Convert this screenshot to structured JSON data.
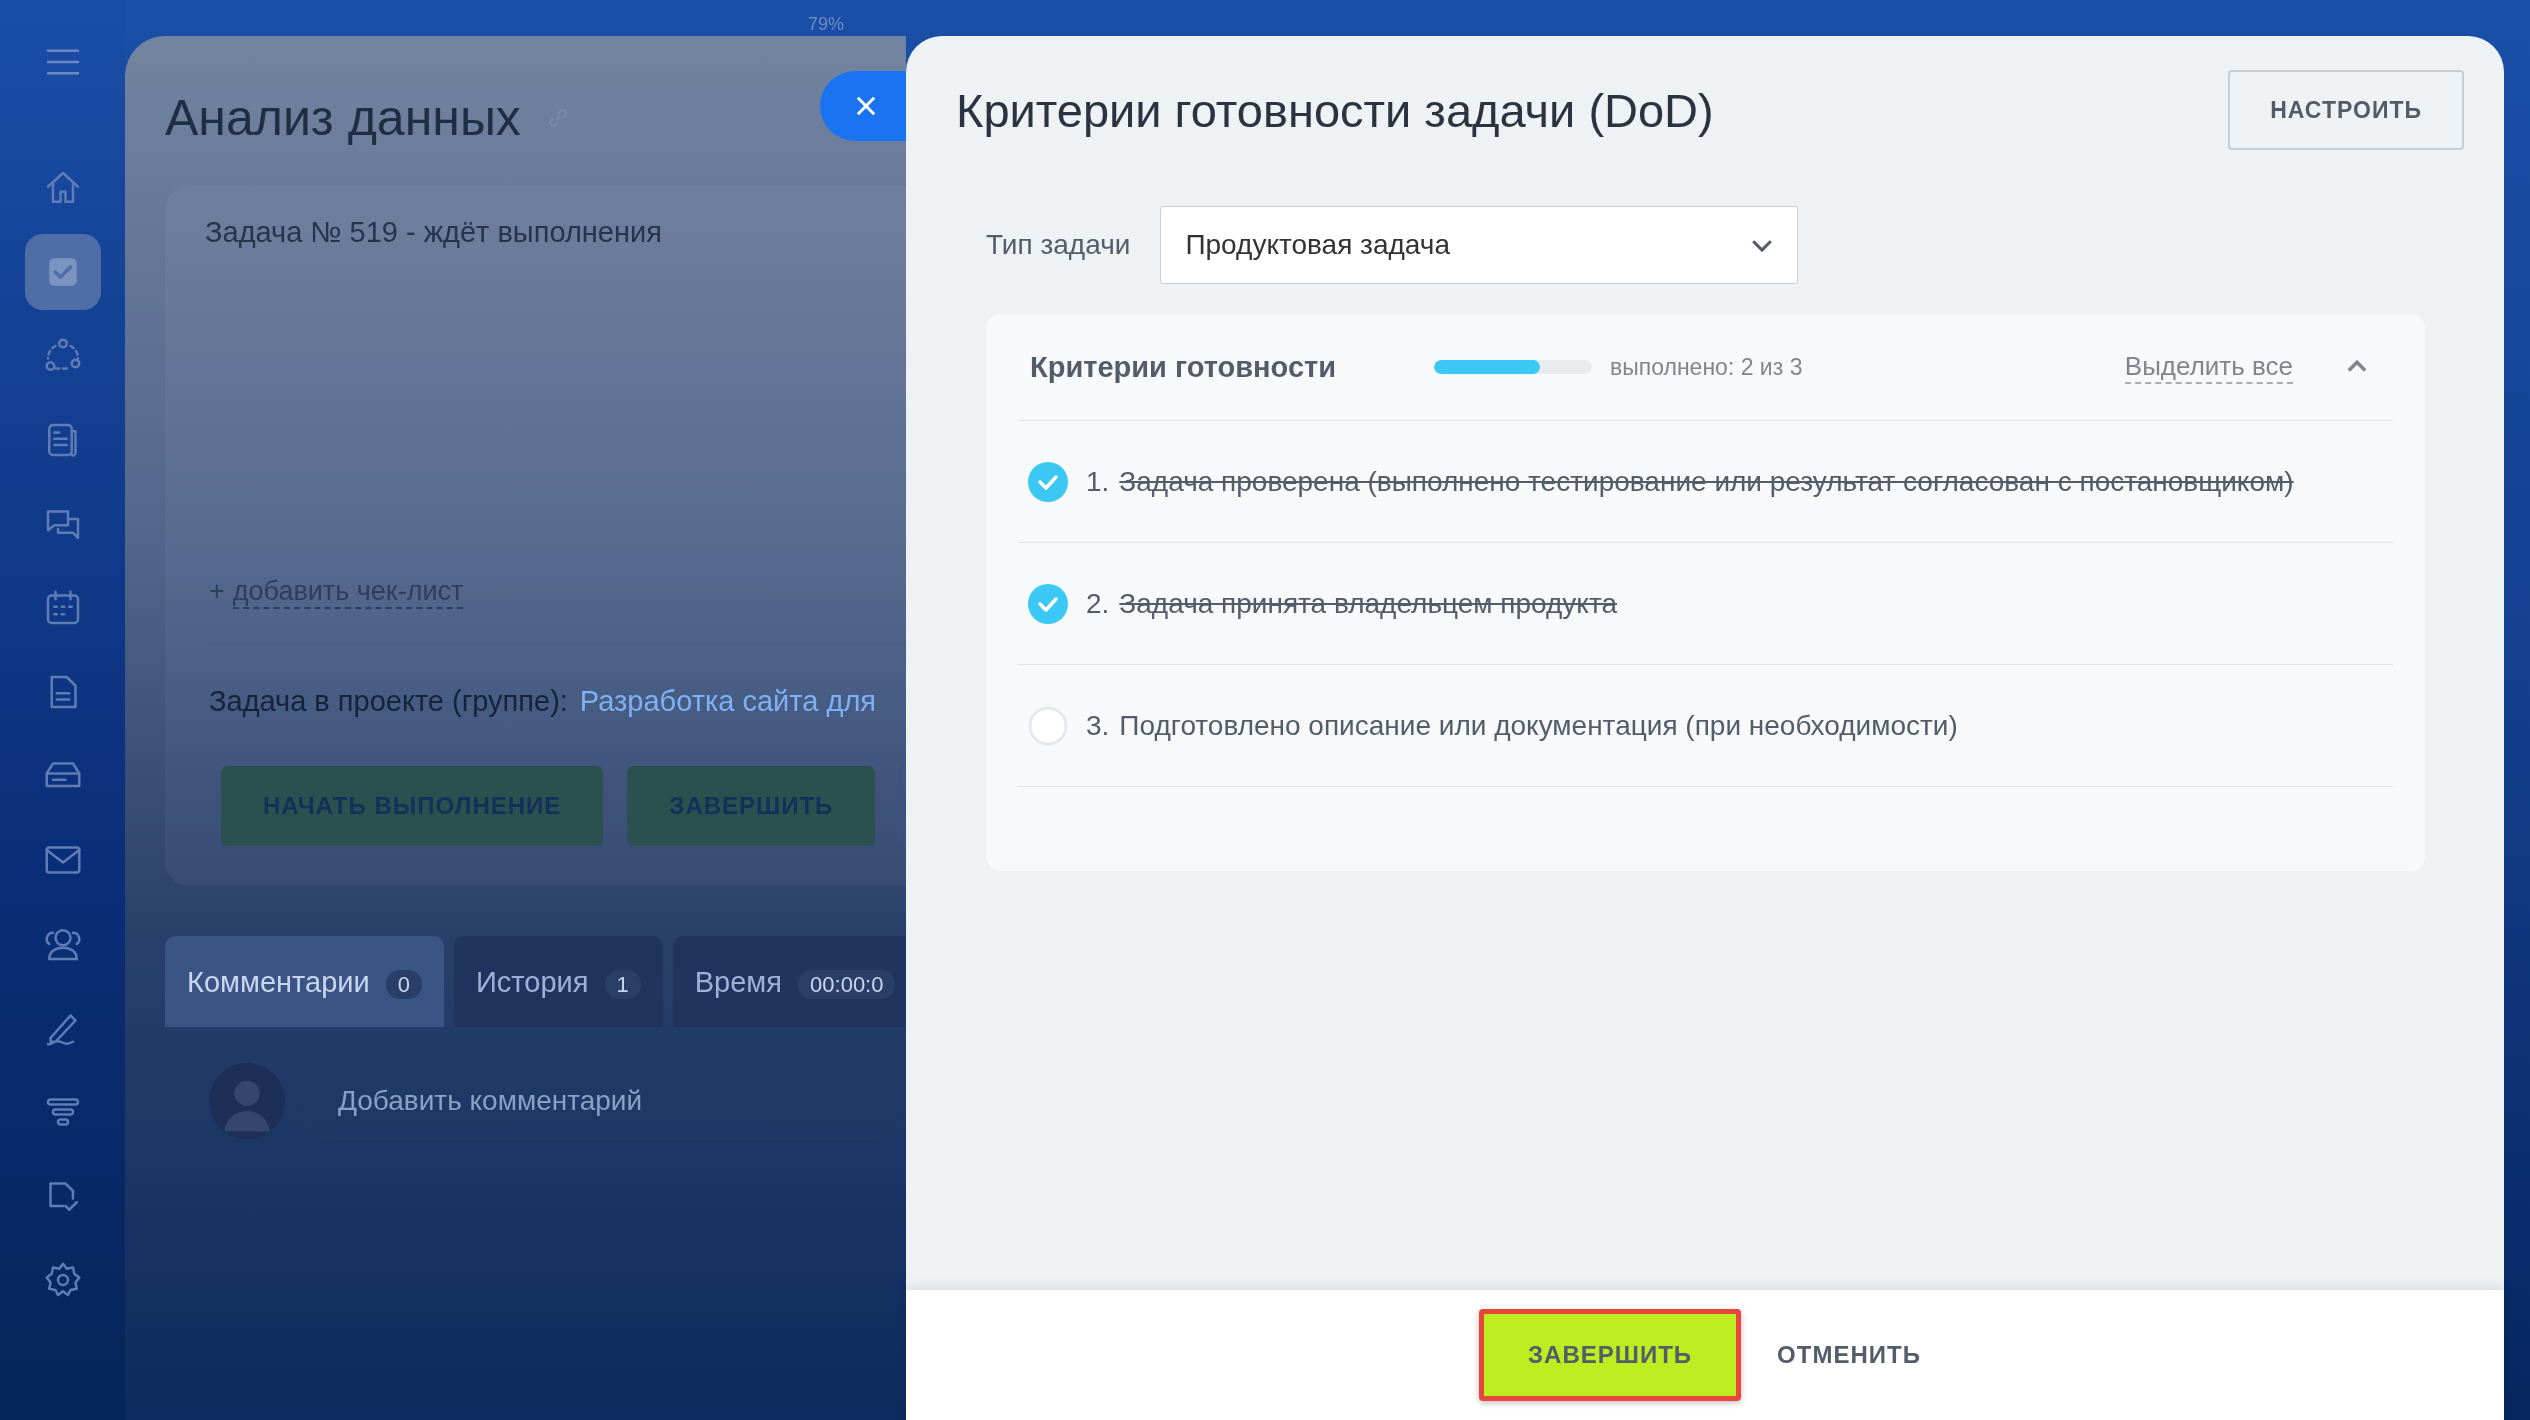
{
  "status_bar": {
    "battery": "79%"
  },
  "sidebar": {
    "items": [
      {
        "kind": "menu",
        "selected": false
      },
      {
        "kind": "home",
        "selected": false
      },
      {
        "kind": "tasks",
        "selected": true
      },
      {
        "kind": "crm",
        "selected": false
      },
      {
        "kind": "feed",
        "selected": false
      },
      {
        "kind": "chat",
        "selected": false
      },
      {
        "kind": "calendar",
        "selected": false
      },
      {
        "kind": "document",
        "selected": false
      },
      {
        "kind": "drive",
        "selected": false
      },
      {
        "kind": "mail",
        "selected": false
      },
      {
        "kind": "contacts",
        "selected": false
      },
      {
        "kind": "sign",
        "selected": false
      },
      {
        "kind": "filter",
        "selected": false
      },
      {
        "kind": "doc-sign",
        "selected": false
      },
      {
        "kind": "settings",
        "selected": false
      }
    ]
  },
  "task": {
    "title": "Анализ данных",
    "status": "Задача № 519 - ждёт выполнения",
    "add_checklist": "добавить чек-лист",
    "add_sign": "+",
    "project_label": "Задача в проекте (группе):",
    "project_link": "Разработка сайта для",
    "buttons": [
      {
        "label": "НАЧАТЬ ВЫПОЛНЕНИЕ"
      },
      {
        "label": "ЗАВЕРШИТЬ"
      }
    ],
    "tabs": [
      {
        "label": "Комментарии",
        "count": "0",
        "selected": true
      },
      {
        "label": "История",
        "count": "1",
        "selected": false
      },
      {
        "label": "Время",
        "count": "00:00:0",
        "selected": false
      }
    ],
    "comment_placeholder": "Добавить комментарий"
  },
  "dialog": {
    "title": "Критерии готовности задачи (DoD)",
    "settings_button": "НАСТРОИТЬ",
    "type_label": "Тип задачи",
    "type_value": "Продуктовая задача",
    "criteria": {
      "title": "Критерии готовности",
      "level": 0.67,
      "progress_text": "выполнено: 2 из 3",
      "select_all": "Выделить все",
      "expanded": true,
      "items": [
        {
          "number": "1.",
          "text": "Задача проверена (выполнено тестирование или результат согласован с постановщиком)",
          "checked": true
        },
        {
          "number": "2.",
          "text": "Задача принята владельцем продукта",
          "checked": true
        },
        {
          "number": "3.",
          "text": "Подготовлено описание или документация (при необходимости)",
          "checked": false
        }
      ]
    },
    "footer": {
      "complete_button": "ЗАВЕРШИТЬ",
      "cancel_button": "ОТМЕНИТЬ"
    }
  }
}
